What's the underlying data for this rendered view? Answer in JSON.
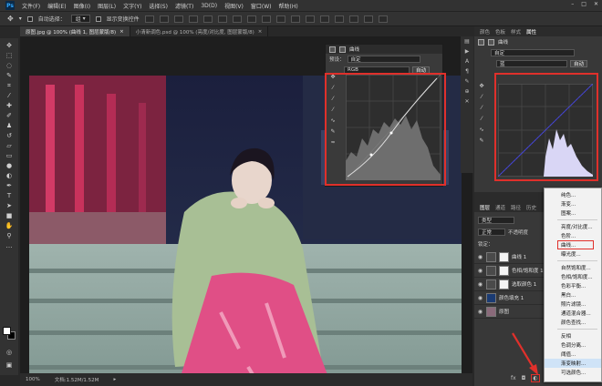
{
  "menubar": {
    "logo": "Ps",
    "items": [
      "文件(F)",
      "编辑(E)",
      "图像(I)",
      "图层(L)",
      "文字(Y)",
      "选择(S)",
      "滤镜(T)",
      "3D(D)",
      "视图(V)",
      "窗口(W)",
      "帮助(H)"
    ]
  },
  "options": {
    "auto_select": "自动选择：",
    "auto_select_value": "组",
    "show_transform": "显示变换控件"
  },
  "tabs": [
    {
      "label": "原图.jpg @ 100% (曲线 1, 图层蒙版/8)",
      "active": true
    },
    {
      "label": "小清新调色.psd @ 100% (亮度/对比度, 图层蒙版/8)",
      "active": false
    }
  ],
  "curves_float": {
    "title": "曲线",
    "preset_label": "预设：",
    "preset_value": "自定",
    "channel": "RGB",
    "auto": "自动"
  },
  "right_panel": {
    "tabs": [
      "颜色",
      "色板",
      "样式",
      "属性"
    ],
    "active_tab": "属性",
    "title": "曲线",
    "preset_value": "自定",
    "channel": "蓝",
    "auto": "自动"
  },
  "layers_panel": {
    "tabs": [
      "图层",
      "通道",
      "路径",
      "历史"
    ],
    "kind_label": "类型",
    "blend_mode": "正常",
    "opacity_label": "不透明度",
    "lock_label": "锁定：",
    "layers": [
      {
        "name": "曲线 1",
        "thumb_color": "#f4f4f4"
      },
      {
        "name": "色相/饱和度 1",
        "thumb_color": "#f4f4f4"
      },
      {
        "name": "选取颜色 1",
        "thumb_color": "#f4f4f4"
      },
      {
        "name": "颜色填充 1",
        "thumb_color": "#1b3b73"
      },
      {
        "name": "原图",
        "thumb_color": "#8a6a7a"
      }
    ]
  },
  "context_menu": {
    "items": [
      "纯色...",
      "渐变...",
      "图案...",
      "---",
      "亮度/对比度...",
      "色阶...",
      "曲线...",
      "曝光度...",
      "---",
      "自然饱和度...",
      "色相/饱和度...",
      "色彩平衡...",
      "黑白...",
      "照片滤镜...",
      "通道混合器...",
      "颜色查找...",
      "---",
      "反相",
      "色调分离...",
      "阈值...",
      "渐变映射...",
      "可选颜色..."
    ],
    "highlighted": "曲线..."
  },
  "status": {
    "zoom": "100%",
    "doc": "文档:1.52M/1.52M"
  },
  "colors": {
    "accent_red": "#e0302b",
    "curve_blue": "#3a3ae0"
  }
}
